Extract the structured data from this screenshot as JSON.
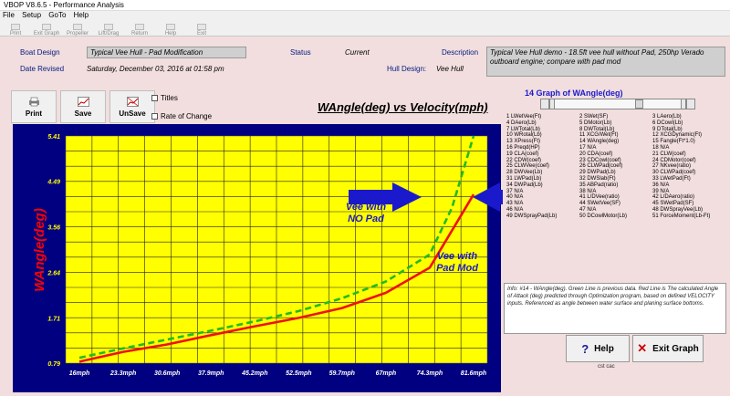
{
  "window": {
    "title": "VBOP V8.6.5 - Performance Analysis"
  },
  "menu": [
    "File",
    "Setup",
    "GoTo",
    "Help"
  ],
  "toolbar": [
    "Print",
    "Exit Graph",
    "Propeller",
    "Lift/Drag",
    "Return",
    "Help",
    "Exit"
  ],
  "header": {
    "boat_design_label": "Boat Design",
    "boat_design_value": "Typical Vee Hull - Pad Modification",
    "status_label": "Status",
    "status_value": "Current",
    "description_label": "Description",
    "description_value": "Typical Vee Hull demo - 18.5ft vee hull without Pad, 250hp Verado outboard engine; compare with pad mod",
    "date_label": "Date Revised",
    "date_value": "Saturday, December 03, 2016 at 01:58 pm",
    "hull_label": "Hull Design:",
    "hull_value": "Vee Hull"
  },
  "chart_buttons": {
    "print": "Print",
    "save": "Save",
    "unsave": "UnSave"
  },
  "checkboxes": {
    "titles": "Titles",
    "rate": "Rate of Change"
  },
  "selector": {
    "heading": "14 Graph of WAngle(deg)"
  },
  "graph_list": [
    "1 LWetVee(Ft)",
    "2 SWet(SF)",
    "3 LAero(Lb)",
    "4 DAero(Lb)",
    "5 DMotor(Lb)",
    "6 DCowl(Lb)",
    "7 LWTotal(Lb)",
    "8 DWTotal(Lb)",
    "9 DTotal(Lb)",
    "10 WRotal(Lb)",
    "11 XCG/Wet(Ft)",
    "12 XCGDynamic(Ft)",
    "13 XPress(Ft)",
    "14 WAngle(deg)",
    "15 Fangle(Ft*1.0)",
    "16 Preqd(HP)",
    "17 N/A",
    "18 N/A",
    "19 CLA(coef)",
    "20 CDA(coef)",
    "21 CLW(coef)",
    "22 CDW(coef)",
    "23 CDCowl(coef)",
    "24 CDMotor(coef)",
    "25 CLWVee(coef)",
    "26 CLWPad(coef)",
    "27 NKvee(ratio)",
    "28 DWVee(Lb)",
    "29 DWPad(Lb)",
    "30 CLWPad(coef)",
    "31 LWPad(Lb)",
    "32 DWSlab(Ft)",
    "33 LWetPad(Ft)",
    "34 DWPad(Lb)",
    "35 ABPad(ratio)",
    "36 N/A",
    "37 N/A",
    "38 N/A",
    "39 N/A",
    "40 N/A",
    "41 L/DVee(ratio)",
    "42 L/DAero(ratio)",
    "43 N/A",
    "44 SWetVee(SF)",
    "45 SWetPad(SF)",
    "46 N/A",
    "47 N/A",
    "48 DWSprayVee(Lb)",
    "49 DWSprayPad(Lb)",
    "50 DCowlMotor(Lb)",
    "51 ForceMoment(Lb-Ft)"
  ],
  "info_text": "Info: #14 - WAngle(deg). Green Line is previous data. Red Line is The calculated Angle of Attack (deg) predicted through Optimization program, based on defined VELOCITY inputs. Referenced as angle between water surface and planing surface bottoms.",
  "buttons": {
    "help": "Help",
    "exit_graph": "Exit Graph"
  },
  "credit": "cst cac",
  "chart_data": {
    "type": "line",
    "title": "WAngle(deg) vs Velocity(mph)",
    "xlabel": "",
    "ylabel": "WAngle(deg)",
    "categories": [
      "16mph",
      "23.3mph",
      "30.6mph",
      "37.9mph",
      "45.2mph",
      "52.5mph",
      "59.7mph",
      "67mph",
      "74.3mph",
      "81.6mph"
    ],
    "yticks": [
      "0.79",
      "1.71",
      "2.64",
      "3.56",
      "4.49",
      "5.41"
    ],
    "ylim": [
      0.79,
      5.41
    ],
    "series": [
      {
        "style": "dashed",
        "color": "#22bb22",
        "x": [
          16,
          23.3,
          30.6,
          37.9,
          45.2,
          52.5,
          59.7,
          67,
          74.3,
          78.0,
          81.6
        ],
        "values": [
          0.9,
          1.09,
          1.27,
          1.45,
          1.64,
          1.85,
          2.11,
          2.45,
          3.0,
          3.95,
          5.41
        ]
      },
      {
        "style": "solid",
        "color": "#ee1111",
        "x": [
          16,
          23.3,
          30.6,
          37.9,
          45.2,
          52.5,
          59.7,
          67,
          74.3,
          81.6
        ],
        "values": [
          0.82,
          1.02,
          1.17,
          1.36,
          1.54,
          1.71,
          1.91,
          2.22,
          2.73,
          4.22
        ]
      }
    ],
    "annotations": [
      "Vee with NO Pad",
      "Vee with Pad Mod"
    ],
    "grid": true
  }
}
